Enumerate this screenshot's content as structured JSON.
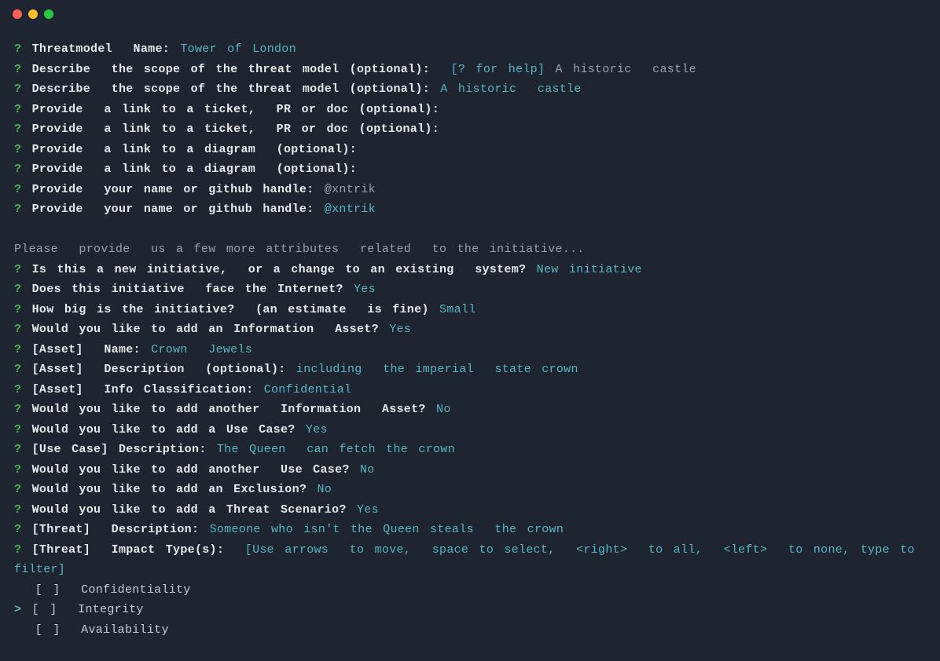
{
  "titlebar": {
    "icons": [
      "close",
      "minimize",
      "maximize"
    ]
  },
  "lines": [
    {
      "marker": "?",
      "prompt": "Threatmodel  Name:",
      "answer": "Tower of London"
    },
    {
      "marker": "?",
      "prompt": "Describe  the scope of the threat model (optional):",
      "hint": "[? for help]",
      "trailing": "A historic  castle"
    },
    {
      "marker": "?",
      "prompt": "Describe  the scope of the threat model (optional):",
      "answer": "A historic  castle"
    },
    {
      "marker": "?",
      "prompt": "Provide  a link to a ticket,  PR or doc (optional):"
    },
    {
      "marker": "?",
      "prompt": "Provide  a link to a ticket,  PR or doc (optional):"
    },
    {
      "marker": "?",
      "prompt": "Provide  a link to a diagram  (optional):"
    },
    {
      "marker": "?",
      "prompt": "Provide  a link to a diagram  (optional):"
    },
    {
      "marker": "?",
      "prompt": "Provide  your name or github handle:",
      "trailing": "@xntrik"
    },
    {
      "marker": "?",
      "prompt": "Provide  your name or github handle:",
      "answer": "@xntrik"
    }
  ],
  "section_header": "Please  provide  us a few more attributes  related  to the initiative...",
  "lines2": [
    {
      "marker": "?",
      "prompt": "Is this a new initiative,  or a change to an existing  system?",
      "answer": "New initiative"
    },
    {
      "marker": "?",
      "prompt": "Does this initiative  face the Internet?",
      "answer": "Yes"
    },
    {
      "marker": "?",
      "prompt": "How big is the initiative?  (an estimate  is fine)",
      "answer": "Small"
    },
    {
      "marker": "?",
      "prompt": "Would you like to add an Information  Asset?",
      "answer": "Yes"
    },
    {
      "marker": "?",
      "prompt": "[Asset]  Name:",
      "answer": "Crown  Jewels"
    },
    {
      "marker": "?",
      "prompt": "[Asset]  Description  (optional):",
      "answer": "including  the imperial  state crown"
    },
    {
      "marker": "?",
      "prompt": "[Asset]  Info Classification:",
      "answer": "Confidential"
    },
    {
      "marker": "?",
      "prompt": "Would you like to add another  Information  Asset?",
      "answer": "No"
    },
    {
      "marker": "?",
      "prompt": "Would you like to add a Use Case?",
      "answer": "Yes"
    },
    {
      "marker": "?",
      "prompt": "[Use Case] Description:",
      "answer": "The Queen  can fetch the crown"
    },
    {
      "marker": "?",
      "prompt": "Would you like to add another  Use Case?",
      "answer": "No"
    },
    {
      "marker": "?",
      "prompt": "Would you like to add an Exclusion?",
      "answer": "No"
    },
    {
      "marker": "?",
      "prompt": "Would you like to add a Threat Scenario?",
      "answer": "Yes"
    },
    {
      "marker": "?",
      "prompt": "[Threat]  Description:",
      "answer": "Someone who isn't the Queen steals  the crown"
    }
  ],
  "impact_prompt": {
    "marker": "?",
    "prompt": "[Threat]  Impact Type(s):",
    "hint": "[Use arrows  to move,  space to select,  <right>  to all,  <left>  to none, type to filter]"
  },
  "checkboxes": [
    {
      "cursor": " ",
      "box": "[ ]",
      "label": "Confidentiality"
    },
    {
      "cursor": ">",
      "box": "[ ]",
      "label": "Integrity"
    },
    {
      "cursor": " ",
      "box": "[ ]",
      "label": "Availability"
    }
  ]
}
